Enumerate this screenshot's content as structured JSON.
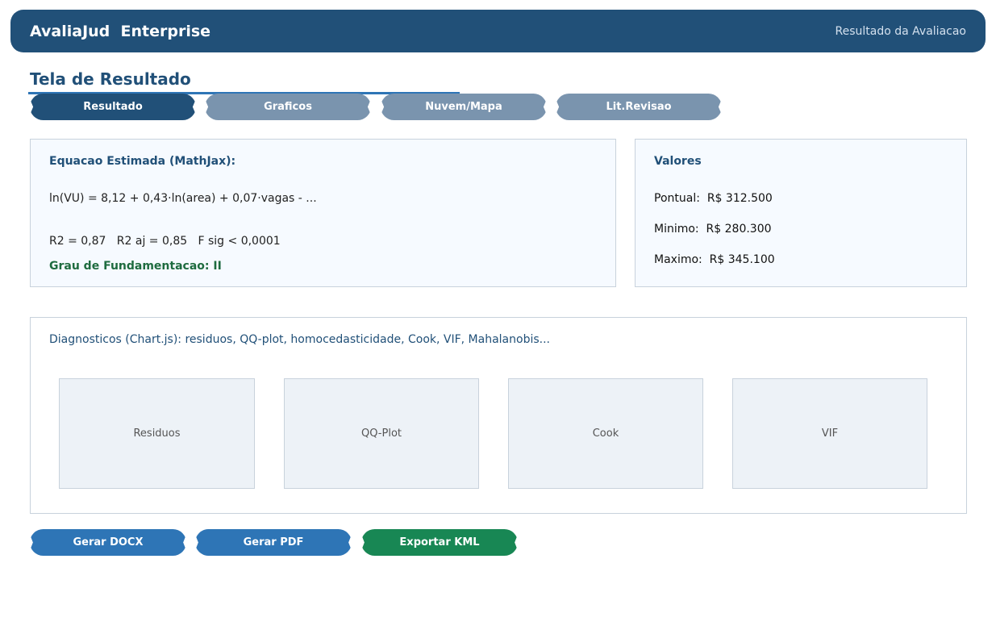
{
  "header": {
    "app_title": "AvaliaJud  Enterprise",
    "subtitle": "Resultado da Avaliacao"
  },
  "page": {
    "title": "Tela de Resultado"
  },
  "tabs": [
    {
      "label": "Resultado",
      "active": true
    },
    {
      "label": "Graficos",
      "active": false
    },
    {
      "label": "Nuvem/Mapa",
      "active": false
    },
    {
      "label": "Lit.Revisao",
      "active": false
    }
  ],
  "equation_panel": {
    "heading": "Equacao Estimada (MathJax):",
    "equation": "ln(VU) = 8,12 + 0,43·ln(area) + 0,07·vagas - ...",
    "stats": "R2 = 0,87   R2 aj = 0,85   F sig < 0,0001",
    "grau": "Grau de Fundamentacao: II"
  },
  "values_panel": {
    "heading": "Valores",
    "pontual": "Pontual:  R$ 312.500",
    "minimo": "Minimo:  R$ 280.300",
    "maximo": "Maximo:  R$ 345.100"
  },
  "diagnostics": {
    "note": "Diagnosticos (Chart.js): residuos, QQ-plot, homocedasticidade, Cook, VIF, Mahalanobis...",
    "charts": [
      "Residuos",
      "QQ-Plot",
      "Cook",
      "VIF"
    ]
  },
  "actions": {
    "docx": "Gerar DOCX",
    "pdf": "Gerar PDF",
    "kml": "Exportar KML"
  },
  "colors": {
    "primary": "#215078",
    "accent": "#2e75b6",
    "tab_inactive": "#7a94ae",
    "success": "#188754",
    "grau_text": "#1e6b3f"
  }
}
